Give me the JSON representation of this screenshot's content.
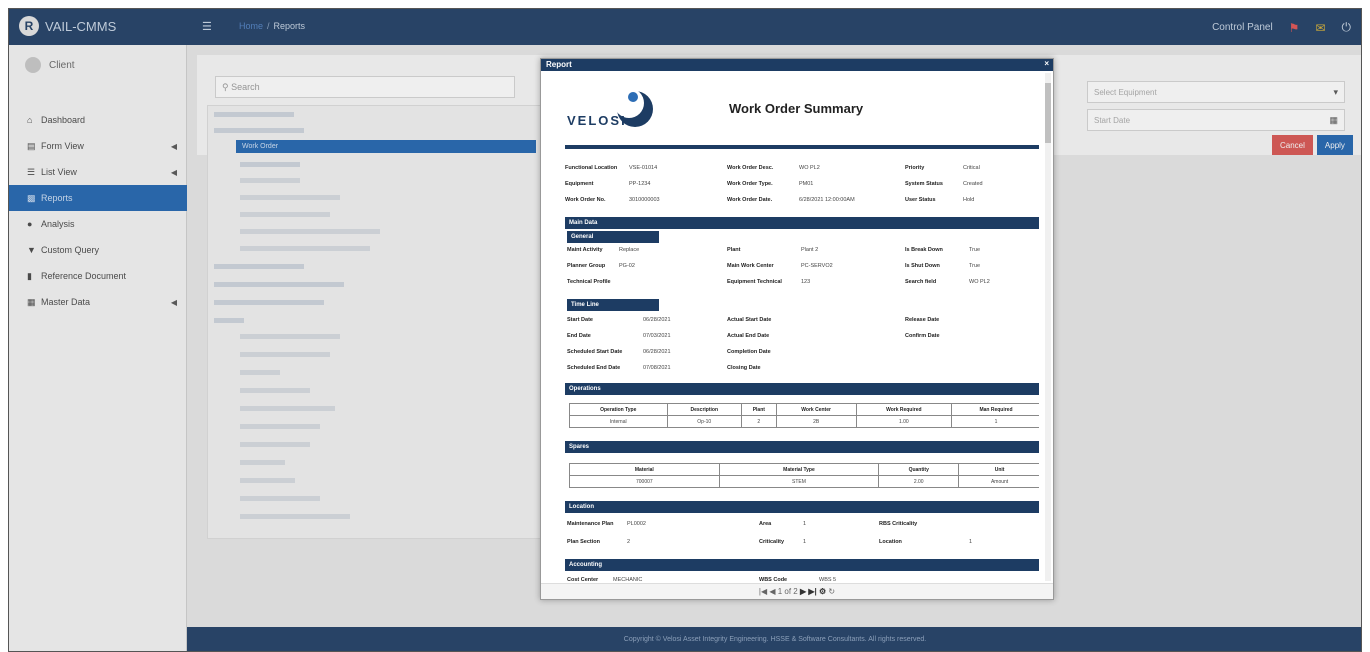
{
  "app": {
    "title": "VAIL-CMMS",
    "logo_letter": "R"
  },
  "topbar": {
    "menu_icon": "hamburger-icon",
    "breadcrumb": [
      "Home",
      "Reports"
    ],
    "control_panel": "Control Panel",
    "icons": [
      "notification-icon",
      "message-icon",
      "power-icon"
    ]
  },
  "sidebar": {
    "user": "Client",
    "items": [
      {
        "label": "Dashboard",
        "icon": "home-icon",
        "has_chevron": false
      },
      {
        "label": "Form View",
        "icon": "form-icon",
        "has_chevron": true
      },
      {
        "label": "List View",
        "icon": "list-icon",
        "has_chevron": true
      },
      {
        "label": "Reports",
        "icon": "chart-icon",
        "has_chevron": false,
        "active": true
      },
      {
        "label": "Analysis",
        "icon": "analysis-icon",
        "has_chevron": false
      },
      {
        "label": "Custom Query",
        "icon": "filter-icon",
        "has_chevron": false
      },
      {
        "label": "Reference Document",
        "icon": "document-icon",
        "has_chevron": false
      },
      {
        "label": "Master Data",
        "icon": "table-icon",
        "has_chevron": true
      }
    ]
  },
  "main": {
    "search_placeholder": "Search",
    "tree": {
      "selected": "Work Order"
    },
    "filters": {
      "equipment_placeholder": "Select Equipment",
      "date_placeholder": "Start Date"
    },
    "buttons": {
      "cancel": "Cancel",
      "apply": "Apply"
    }
  },
  "footer": {
    "text": "Copyright © Velosi Asset Integrity Engineering. HSSE & Software Consultants. All rights reserved."
  },
  "modal": {
    "title": "Report",
    "close": "×",
    "logo": "VELOSI",
    "report_title": "Work Order Summary",
    "header_fields": [
      {
        "label": "Functional Location",
        "value": "VSE-01014"
      },
      {
        "label": "Work Order Desc.",
        "value": "WO PL2"
      },
      {
        "label": "Priority",
        "value": "Critical"
      },
      {
        "label": "Equipment",
        "value": "PP-1234"
      },
      {
        "label": "Work Order Type.",
        "value": "PM01"
      },
      {
        "label": "System Status",
        "value": "Created"
      },
      {
        "label": "Work Order No.",
        "value": "3010000003"
      },
      {
        "label": "Work Order Date.",
        "value": "6/28/2021 12:00:00AM"
      },
      {
        "label": "User Status",
        "value": "Hold"
      }
    ],
    "main_data": {
      "section": "Main Data",
      "general": "General",
      "fields": [
        {
          "label": "Maint Activity",
          "value": "Replace"
        },
        {
          "label": "Plant",
          "value": "Plant 2"
        },
        {
          "label": "Is Break Down",
          "value": "True"
        },
        {
          "label": "Planner Group",
          "value": "PG-02"
        },
        {
          "label": "Main Work Center",
          "value": "PC-SERVO2"
        },
        {
          "label": "Is Shut Down",
          "value": "True"
        },
        {
          "label": "Technical Profile",
          "value": ""
        },
        {
          "label": "Equipment Technical",
          "value": "123"
        },
        {
          "label": "Search field",
          "value": "WO PL2"
        }
      ]
    },
    "time_line": {
      "title": "Time Line",
      "fields": [
        {
          "label": "Start Date",
          "value": "06/28/2021"
        },
        {
          "label": "Actual Start Date",
          "value": ""
        },
        {
          "label": "Release Date",
          "value": ""
        },
        {
          "label": "End Date",
          "value": "07/03/2021"
        },
        {
          "label": "Actual End Date",
          "value": ""
        },
        {
          "label": "Confirm Date",
          "value": ""
        },
        {
          "label": "Scheduled Start Date",
          "value": "06/28/2021"
        },
        {
          "label": "Completion Date",
          "value": ""
        },
        {
          "label": "Scheduled End Date",
          "value": "07/08/2021"
        },
        {
          "label": "Closing Date",
          "value": ""
        }
      ]
    },
    "operations": {
      "title": "Operations",
      "headers": [
        "Operation Type",
        "Description",
        "Plant",
        "Work Center",
        "Work Required",
        "Man Required"
      ],
      "rows": [
        [
          "Internal",
          "Op-10",
          "2",
          "2B",
          "1.00",
          "1"
        ]
      ]
    },
    "spares": {
      "title": "Spares",
      "headers": [
        "Material",
        "Material Type",
        "Quantity",
        "Unit"
      ],
      "rows": [
        [
          "700007",
          "STEM",
          "2.00",
          "Amount"
        ]
      ]
    },
    "location": {
      "title": "Location",
      "fields": [
        {
          "label": "Maintenance Plan",
          "value": "PL0002"
        },
        {
          "label": "Area",
          "value": "1"
        },
        {
          "label": "RBS Criticality",
          "value": ""
        },
        {
          "label": "Plan Section",
          "value": "2"
        },
        {
          "label": "Criticality",
          "value": "1"
        },
        {
          "label": "Location",
          "value": "1"
        }
      ]
    },
    "accounting": {
      "title": "Accounting",
      "fields": [
        {
          "label": "Cost Center",
          "value": "MECHANIC"
        },
        {
          "label": "WBS Code",
          "value": "WBS 5"
        }
      ]
    },
    "pager": {
      "page": "1 of 2"
    }
  }
}
